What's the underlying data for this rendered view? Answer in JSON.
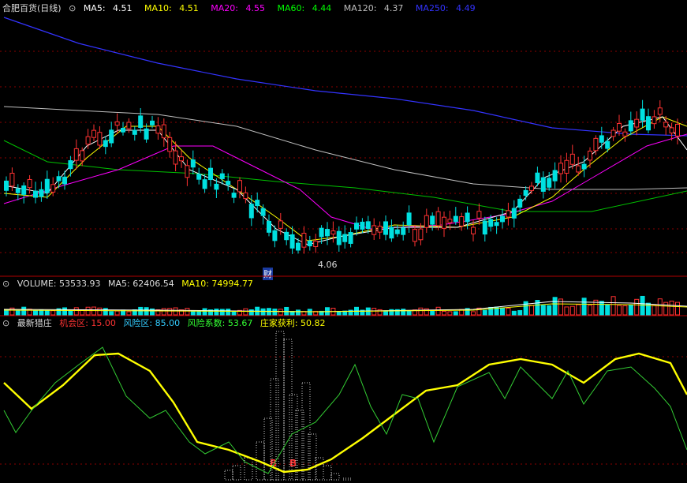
{
  "price_panel": {
    "title": "合肥百货(日线)",
    "collapse_icon": "circle-arrow-icon",
    "ma": [
      {
        "label": "MA5:",
        "value": "4.51",
        "color": "#ffffff"
      },
      {
        "label": "MA10:",
        "value": "4.51",
        "color": "#ffff00"
      },
      {
        "label": "MA20:",
        "value": "4.55",
        "color": "#ff00ff"
      },
      {
        "label": "MA60:",
        "value": "4.44",
        "color": "#00ff00"
      },
      {
        "label": "MA120:",
        "value": "4.37",
        "color": "#bfbfbf"
      },
      {
        "label": "MA250:",
        "value": "4.49",
        "color": "#3333ff"
      }
    ],
    "low_label": "4.06",
    "event_tag": "财"
  },
  "volume_panel": {
    "label": "VOLUME: 53533.93",
    "ma5": "MA5: 62406.54",
    "ma10": "MA10: 74994.77"
  },
  "indicator_panel": {
    "name": "最新猎庄",
    "items": [
      {
        "label": "机会区: 15.00",
        "color": "#ff3333"
      },
      {
        "label": "风险区: 85.00",
        "color": "#33ccff"
      },
      {
        "label": "风险系数: 53.67",
        "color": "#33ff33"
      },
      {
        "label": "庄家获利: 50.82",
        "color": "#ffff00"
      }
    ],
    "buy_marks": [
      "B",
      "B"
    ]
  },
  "colors": {
    "up": "#ff3232",
    "down": "#00e0e0",
    "grid": "#8b0000"
  }
}
